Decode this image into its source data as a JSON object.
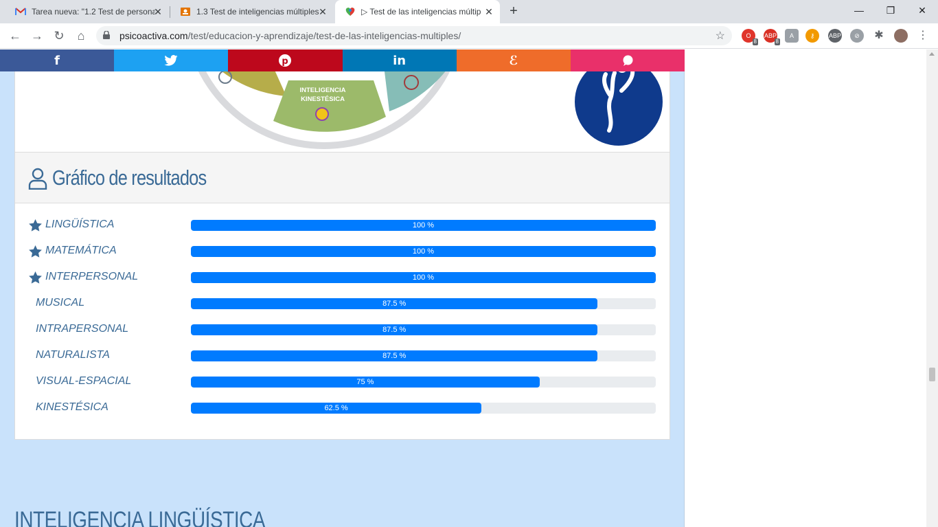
{
  "browser": {
    "tabs": [
      {
        "title": "Tarea nueva: \"1.2 Test de persona",
        "icon": "gmail-icon",
        "active": false
      },
      {
        "title": "1.3 Test de inteligencias múltiples",
        "icon": "classroom-icon",
        "active": false
      },
      {
        "title": "▷ Test de las inteligencias múltip",
        "icon": "psicoactiva-icon",
        "active": true
      }
    ],
    "new_tab_label": "+",
    "window_controls": {
      "minimize": "—",
      "restore": "❐",
      "close": "✕"
    },
    "url_host": "psicoactiva.com",
    "url_path": "/test/educacion-y-aprendizaje/test-de-las-inteligencias-multiples/",
    "extensions": [
      {
        "icon": "opera-icon",
        "badge": "8",
        "color": "#e0352b"
      },
      {
        "icon": "adblock-icon",
        "badge": "8",
        "color": "#d93025"
      },
      {
        "icon": "pdf-icon",
        "badge": "",
        "color": "#9aa0a6"
      },
      {
        "icon": "key-icon",
        "badge": "",
        "color": "#f29900"
      },
      {
        "icon": "abp-icon",
        "badge": "",
        "color": "#5f6368"
      },
      {
        "icon": "compass-icon",
        "badge": "",
        "color": "#9aa0a6"
      },
      {
        "icon": "puzzle-icon",
        "badge": "",
        "color": "#5f6368"
      }
    ]
  },
  "share": [
    {
      "name": "facebook",
      "glyph": "f",
      "color": "#3b5998"
    },
    {
      "name": "twitter",
      "glyph": "🐦",
      "color": "#1da1f2"
    },
    {
      "name": "pinterest",
      "glyph": "P",
      "color": "#bd081c"
    },
    {
      "name": "linkedin",
      "glyph": "in",
      "color": "#0077b5"
    },
    {
      "name": "meneame",
      "glyph": "ℰ",
      "color": "#ef6c2a"
    },
    {
      "name": "whatsapp",
      "glyph": "●",
      "color": "#e9306a"
    }
  ],
  "wheel": {
    "segment_label_line1": "INTELIGENCIA",
    "segment_label_line2": "KINESTÉSICA"
  },
  "results": {
    "title": "Gráfico de resultados",
    "rows": [
      {
        "label": "LINGÜÍSTICA",
        "value": 100,
        "pct_label": "100 %",
        "starred": true
      },
      {
        "label": "MATEMÁTICA",
        "value": 100,
        "pct_label": "100 %",
        "starred": true
      },
      {
        "label": "INTERPERSONAL",
        "value": 100,
        "pct_label": "100 %",
        "starred": true
      },
      {
        "label": "MUSICAL",
        "value": 87.5,
        "pct_label": "87.5 %",
        "starred": false
      },
      {
        "label": "INTRAPERSONAL",
        "value": 87.5,
        "pct_label": "87.5 %",
        "starred": false
      },
      {
        "label": "NATURALISTA",
        "value": 87.5,
        "pct_label": "87.5 %",
        "starred": false
      },
      {
        "label": "VISUAL-ESPACIAL",
        "value": 75,
        "pct_label": "75 %",
        "starred": false
      },
      {
        "label": "KINESTÉSICA",
        "value": 62.5,
        "pct_label": "62.5 %",
        "starred": false
      }
    ]
  },
  "next_section": {
    "heading": "INTELIGENCIA LINGÜÍSTICA"
  },
  "colors": {
    "accent": "#3a6a96",
    "bar": "#007bff",
    "page_bg": "#c9e2fb"
  }
}
